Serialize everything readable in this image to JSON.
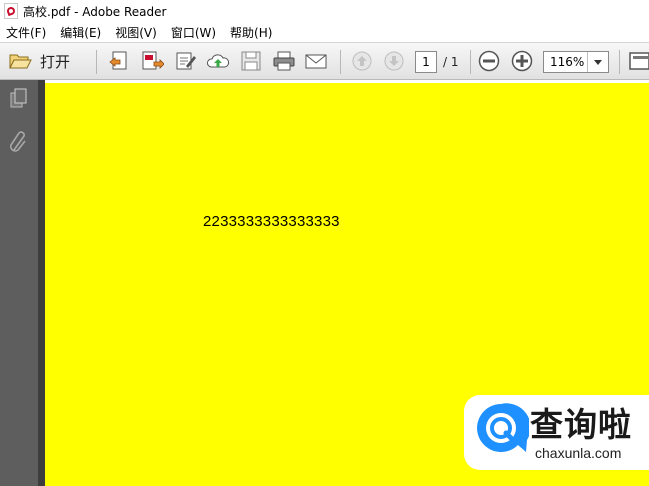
{
  "window": {
    "title": "高校.pdf - Adobe Reader",
    "icon": "pdf-icon"
  },
  "menu": [
    "文件(F)",
    "编辑(E)",
    "视图(V)",
    "窗口(W)",
    "帮助(H)"
  ],
  "toolbar": {
    "open_label": "打开",
    "page_current": "1",
    "page_total": "/ 1",
    "zoom": "116%",
    "icons": [
      "folder-open-icon",
      "create-pdf-icon",
      "export-pdf-icon",
      "sign-icon",
      "upload-cloud-icon",
      "save-icon",
      "print-icon",
      "email-icon",
      "prev-page-icon",
      "next-page-icon",
      "zoom-out-icon",
      "zoom-in-icon",
      "fit-width-icon"
    ]
  },
  "sidebar": {
    "icons": [
      "pages-icon",
      "attachments-icon"
    ]
  },
  "document": {
    "text": "2233333333333333",
    "background": "#ffff00"
  },
  "watermark": {
    "cn": "查询啦",
    "en": "chaxunla.com",
    "color": "#1e90ff"
  }
}
